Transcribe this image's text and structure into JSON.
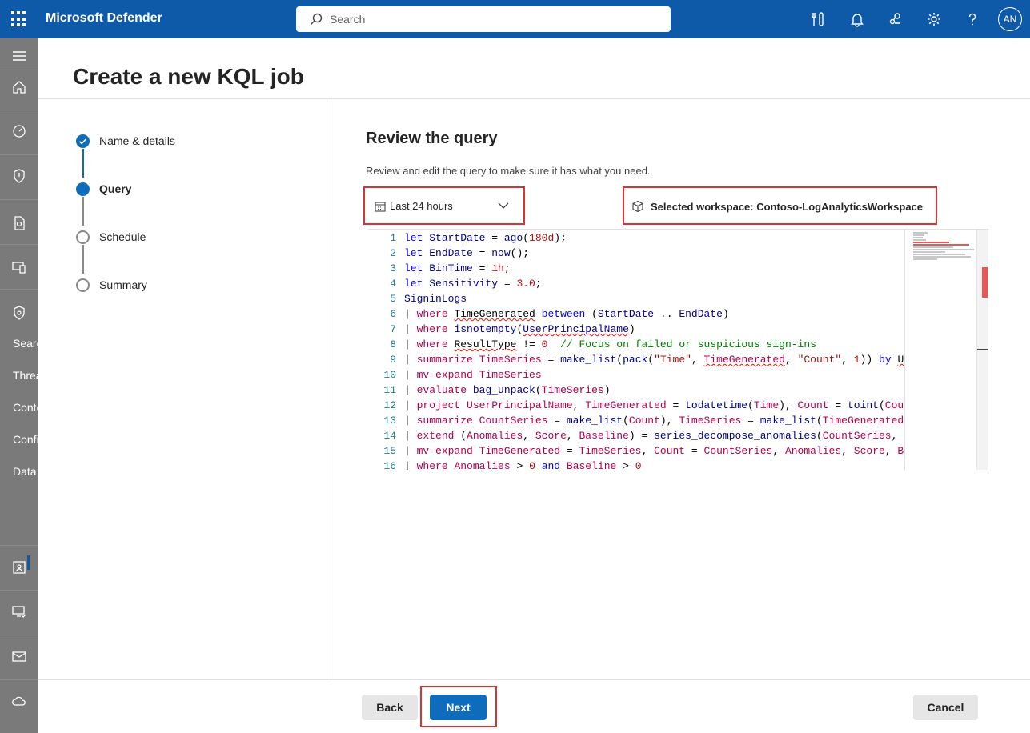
{
  "app": {
    "title": "Microsoft Defender",
    "user_initials": "AN"
  },
  "search": {
    "placeholder": "Search"
  },
  "topbar_icons": [
    "tools-icon",
    "bell-icon",
    "share-icon",
    "gear-icon",
    "help-icon"
  ],
  "left_nav": {
    "icons": [
      "menu-icon",
      "home-icon",
      "gauge-icon",
      "shield-icon",
      "document-search-icon",
      "devices-icon",
      "shield-gear-icon"
    ],
    "labels": [
      "Search",
      "Threa",
      "Conte",
      "Confi",
      "Data"
    ],
    "bottom_icons": [
      "identity-card-icon",
      "desktop-check-icon",
      "mail-icon",
      "cloud-icon"
    ]
  },
  "page": {
    "title": "Create a new KQL job"
  },
  "steps": [
    {
      "label": "Name & details",
      "state": "done"
    },
    {
      "label": "Query",
      "state": "current"
    },
    {
      "label": "Schedule",
      "state": "todo"
    },
    {
      "label": "Summary",
      "state": "todo"
    }
  ],
  "review": {
    "title": "Review the query",
    "description": "Review and edit the query to make sure it has what you need.",
    "time_range": "Last 24 hours",
    "workspace": "Selected workspace: Contoso-LogAnalyticsWorkspace"
  },
  "query_lines": [
    "let StartDate = ago(180d);",
    "let EndDate = now();",
    "let BinTime = 1h;",
    "let Sensitivity = 3.0;",
    "SigninLogs",
    "| where TimeGenerated between (StartDate .. EndDate)",
    "| where isnotempty(UserPrincipalName)",
    "| where ResultType != 0  // Focus on failed or suspicious sign-ins",
    "| summarize TimeSeries = make_list(pack(\"Time\", TimeGenerated, \"Count\", 1)) by Use",
    "| mv-expand TimeSeries",
    "| evaluate bag_unpack(TimeSeries)",
    "| project UserPrincipalName, TimeGenerated = todatetime(Time), Count = toint(Count",
    "| summarize CountSeries = make_list(Count), TimeSeries = make_list(TimeGenerated)",
    "| extend (Anomalies, Score, Baseline) = series_decompose_anomalies(CountSeries, Se",
    "| mv-expand TimeGenerated = TimeSeries, Count = CountSeries, Anomalies, Score, Bas",
    "| where Anomalies > 0 and Baseline > 0"
  ],
  "footer": {
    "back": "Back",
    "next": "Next",
    "cancel": "Cancel"
  },
  "colors": {
    "topbar": "#0f5aa8",
    "primary": "#0f6cbd",
    "highlight": "#d93434"
  }
}
